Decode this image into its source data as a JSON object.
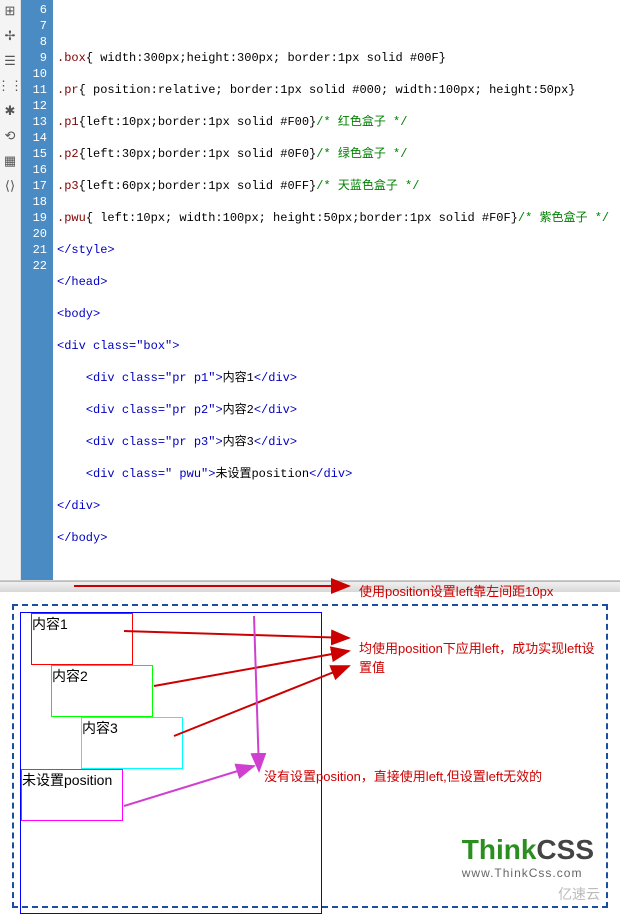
{
  "gutter": {
    "start": 6,
    "end": 22
  },
  "code": {
    "l7": {
      "sel": ".box",
      "rule": "{ width:300px;height:300px; border:1px solid #00F}"
    },
    "l8": {
      "sel": ".pr",
      "rule": "{ position:relative; border:1px solid #000; width:100px; height:50px}"
    },
    "l9": {
      "sel": ".p1",
      "rule": "{left:10px;border:1px solid #F00}",
      "cmt": "/* 红色盒子 */"
    },
    "l10": {
      "sel": ".p2",
      "rule": "{left:30px;border:1px solid #0F0}",
      "cmt": "/* 绿色盒子 */"
    },
    "l11": {
      "sel": ".p3",
      "rule": "{left:60px;border:1px solid #0FF}",
      "cmt": "/* 天蓝色盒子 */"
    },
    "l12": {
      "sel": ".pwu",
      "rule": "{ left:10px; width:100px; height:50px;border:1px solid #F0F}",
      "cmt": "/* 紫色盒子 */"
    },
    "l13": "</style>",
    "l14": "</head>",
    "l15": "<body>",
    "l16": {
      "open": "<div class=",
      "val": "\"box\"",
      "close": ">"
    },
    "l17": {
      "indent": "    ",
      "open": "<div class=",
      "val": "\"pr p1\"",
      "close": ">",
      "text": "内容1",
      "end": "</div>"
    },
    "l18": {
      "indent": "    ",
      "open": "<div class=",
      "val": "\"pr p2\"",
      "close": ">",
      "text": "内容2",
      "end": "</div>"
    },
    "l19": {
      "indent": "    ",
      "open": "<div class=",
      "val": "\"pr p3\"",
      "close": ">",
      "text": "内容3",
      "end": "</div>"
    },
    "l20": {
      "indent": "    ",
      "open": "<div class=",
      "val": "\" pwu\"",
      "close": ">",
      "text": "未设置position",
      "end": "</div>"
    },
    "l21": "</div>",
    "l22": "</body>"
  },
  "preview": {
    "p1_label": "内容1",
    "p2_label": "内容2",
    "p3_label": "内容3",
    "pwu_label": "未设置position"
  },
  "annotations": {
    "a1": "使用position设置left靠左间距10px",
    "a2": "均使用position下应用left，成功实现left设置值",
    "a3": "没有设置position，直接使用left,但设置left无效的"
  },
  "logo": {
    "part1": "Think",
    "part2": "CSS",
    "url": "www.ThinkCss.com"
  },
  "watermark": "亿速云"
}
